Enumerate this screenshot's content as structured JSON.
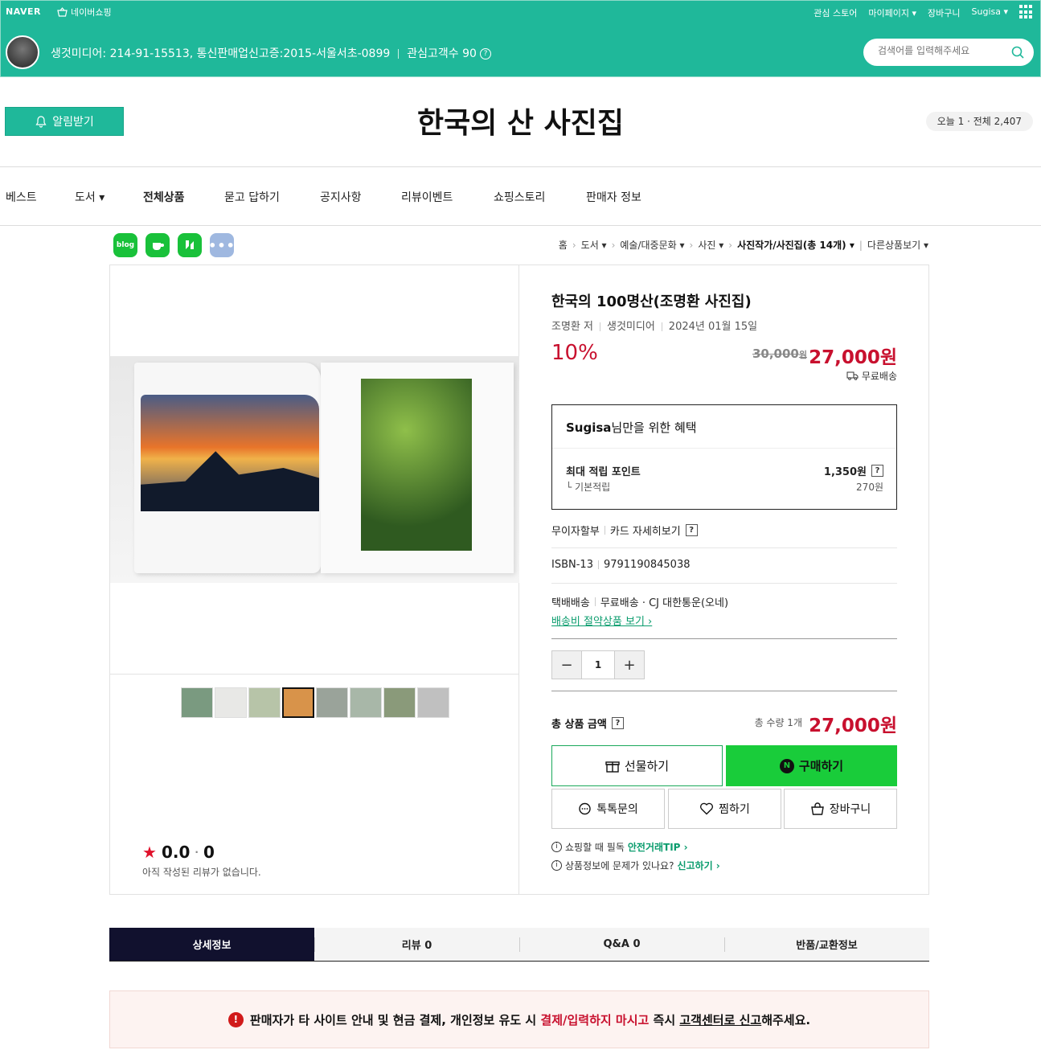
{
  "topbar": {
    "logo": "NAVER",
    "shopping": "네이버쇼핑",
    "links": [
      "관심 스토어",
      "마이페이지 ▾",
      "장바구니",
      "Sugisa ▾"
    ],
    "seller_line": "생것미디어: 214-91-15513, 통신판매업신고증:2015-서울서초-0899",
    "followers": "관심고객수 90",
    "search_placeholder": "검색어를 입력해주세요"
  },
  "header": {
    "alarm_label": "알림받기",
    "store_title": "한국의 산 사진집",
    "visits": "오늘 1 · 전체 2,407"
  },
  "nav": [
    "베스트",
    "도서 ▾",
    "전체상품",
    "묻고 답하기",
    "공지사항",
    "리뷰이벤트",
    "쇼핑스토리",
    "판매자 정보"
  ],
  "share": {
    "blog": "blog",
    "more": "•••"
  },
  "breadcrumb": [
    "홈",
    "도서 ▾",
    "예술/대중문화 ▾",
    "사진 ▾",
    "사진작가/사진집(총 14개) ▾",
    "다른상품보기 ▾"
  ],
  "product": {
    "title": "한국의 100명산(조명환 사진집)",
    "author": "조명환 저",
    "publisher": "생것미디어",
    "date": "2024년 01월 15일",
    "discount": "10%",
    "original_price": "30,000",
    "original_unit": "원",
    "price": "27,000원",
    "shipping": "무료배송"
  },
  "benefit": {
    "user": "Sugisa",
    "title_suffix": "님만을 위한 혜택",
    "max_point_label": "최대 적립 포인트",
    "max_point": "1,350원",
    "base_label": "└ 기본적립",
    "base_point": "270원"
  },
  "details": {
    "installment": "무이자할부",
    "card": "카드 자세히보기",
    "isbn_label": "ISBN-13",
    "isbn": "9791190845038",
    "delivery_label": "택배배송",
    "delivery": "무료배송 · CJ 대한통운(오네)",
    "save_link": "배송비 절약상품 보기 ›"
  },
  "order": {
    "minus": "−",
    "quantity": "1",
    "plus": "+",
    "total_label": "총 상품 금액",
    "total_qty": "총 수량 1개",
    "total_price": "27,000원",
    "gift": "선물하기",
    "buy": "구매하기",
    "talk": "톡톡문의",
    "wish": "찜하기",
    "cart": "장바구니",
    "tip1_text": "쇼핑할 때 필독",
    "tip1_link": "안전거래TIP ›",
    "tip2_text": "상품정보에 문제가 있나요?",
    "tip2_link": "신고하기 ›"
  },
  "rating": {
    "score": "0.0",
    "count": "0",
    "empty": "아직 작성된 리뷰가 없습니다."
  },
  "tabs": [
    "상세정보",
    "리뷰 0",
    "Q&A 0",
    "반품/교환정보"
  ],
  "warning": {
    "part1": "판매자가 타 사이트 안내 및 현금 결제, 개인정보 유도 시 ",
    "part2": "결제/입력하지 마시고",
    "part3": " 즉시 ",
    "part4": "고객센터로 신고",
    "part5": "해주세요."
  },
  "colors": {
    "brand": "#1fb89a",
    "price_red": "#c8102e",
    "buy_green": "#19cc3a",
    "tab_dark": "#11112e"
  }
}
